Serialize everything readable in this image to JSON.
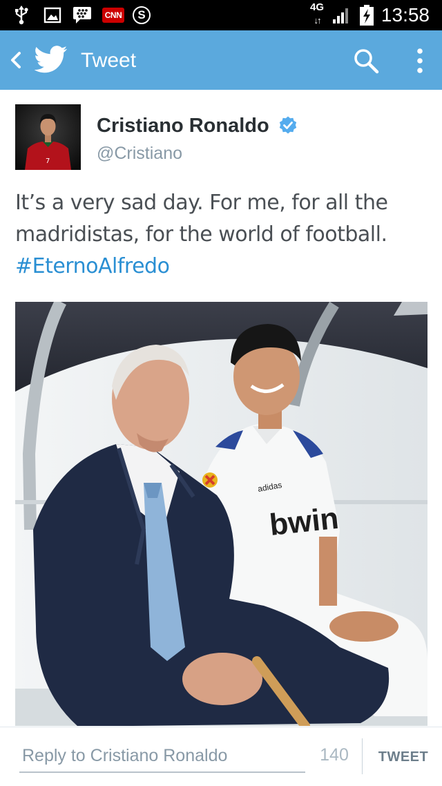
{
  "status_bar": {
    "network": "4G",
    "time": "13:58",
    "icons": [
      "usb-icon",
      "gallery-icon",
      "bbm-icon",
      "cnn-icon",
      "skype-icon",
      "signal-icon",
      "battery-charging-icon"
    ],
    "cnn_label": "CNN",
    "skype_label": "S"
  },
  "action_bar": {
    "title": "Tweet",
    "background": "#5ba9dd",
    "icons": [
      "back-icon",
      "twitter-bird-icon",
      "search-icon",
      "overflow-menu-icon"
    ]
  },
  "tweet": {
    "author_name": "Cristiano Ronaldo",
    "author_handle": "@Cristiano",
    "verified": true,
    "text": "It’s a very sad day. For me, for all the madridistas, for the world of football.",
    "hashtag": "#EternoAlfredo",
    "jersey_number": "7",
    "photo_texts": {
      "sponsor": "bwin",
      "kit_brand": "adidas"
    }
  },
  "reply_bar": {
    "placeholder": "Reply to Cristiano Ronaldo",
    "char_count": "140",
    "tweet_button_label": "TWEET"
  },
  "colors": {
    "accent": "#5ba9dd",
    "hashtag": "#2a8fd3",
    "verified": "#55acee"
  }
}
